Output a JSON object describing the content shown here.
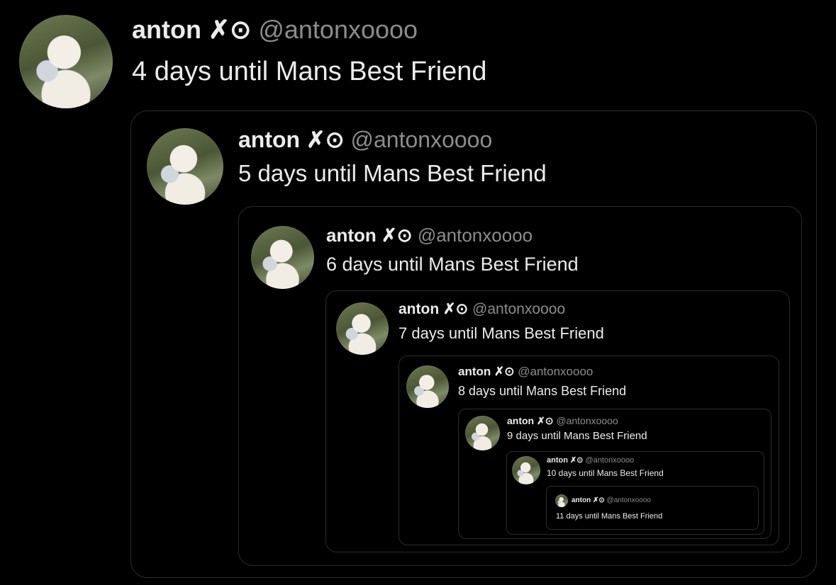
{
  "tweets": [
    {
      "name": "anton",
      "mark": "✗⊙",
      "handle": "@antonxoooo",
      "text": "4 days until Mans Best Friend"
    },
    {
      "name": "anton",
      "mark": "✗⊙",
      "handle": "@antonxoooo",
      "text": "5 days until Mans Best Friend"
    },
    {
      "name": "anton",
      "mark": "✗⊙",
      "handle": "@antonxoooo",
      "text": "6 days until Mans Best Friend"
    },
    {
      "name": "anton",
      "mark": "✗⊙",
      "handle": "@antonxoooo",
      "text": "7 days until Mans Best Friend"
    },
    {
      "name": "anton",
      "mark": "✗⊙",
      "handle": "@antonxoooo",
      "text": "8 days until Mans Best Friend"
    },
    {
      "name": "anton",
      "mark": "✗⊙",
      "handle": "@antonxoooo",
      "text": "9 days until Mans Best Friend"
    },
    {
      "name": "anton",
      "mark": "✗⊙",
      "handle": "@antonxoooo",
      "text": "10 days until Mans Best Friend"
    },
    {
      "name": "anton",
      "mark": "✗⊙",
      "handle": "@antonxoooo",
      "text": "11 days until Mans Best Friend"
    }
  ]
}
